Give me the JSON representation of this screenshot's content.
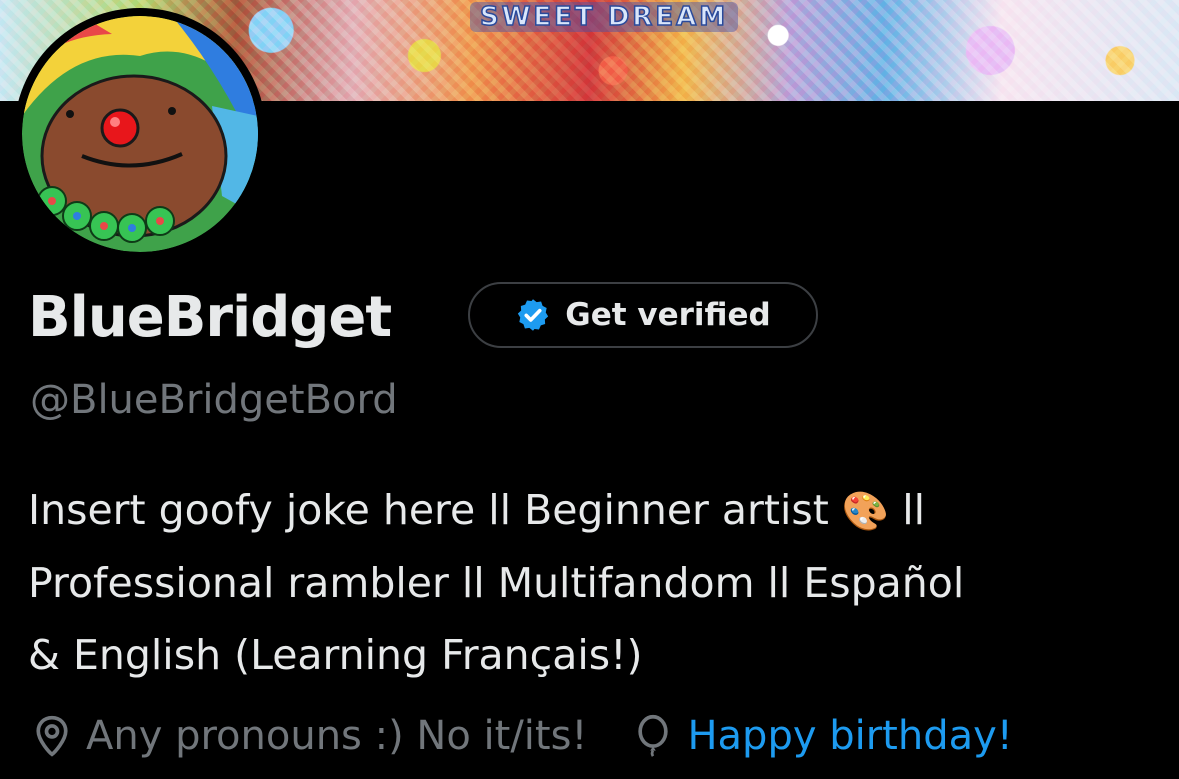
{
  "banner": {
    "title": "SWEET DREAM"
  },
  "profile": {
    "display_name": "BlueBridget",
    "verify_label": "Get verified",
    "handle": "@BlueBridgetBord",
    "bio_lines": [
      "Insert goofy joke here ll Beginner artist",
      "Professional rambler ll Multifandom ll Español",
      "& English (Learning Français!)"
    ],
    "bio_emoji": "🎨",
    "bio_line1_suffix": "ll",
    "location": "Any pronouns :) No it/its!",
    "birthday": "Happy birthday!"
  },
  "icons": {
    "verified_badge": "verified-badge-icon",
    "location": "location-pin-icon",
    "birthday": "balloon-icon",
    "palette": "artist-palette-emoji"
  },
  "colors": {
    "background": "#000000",
    "text": "#e7e9ea",
    "muted": "#71767b",
    "link": "#1d9bf0",
    "badge": "#1d9bf0"
  }
}
